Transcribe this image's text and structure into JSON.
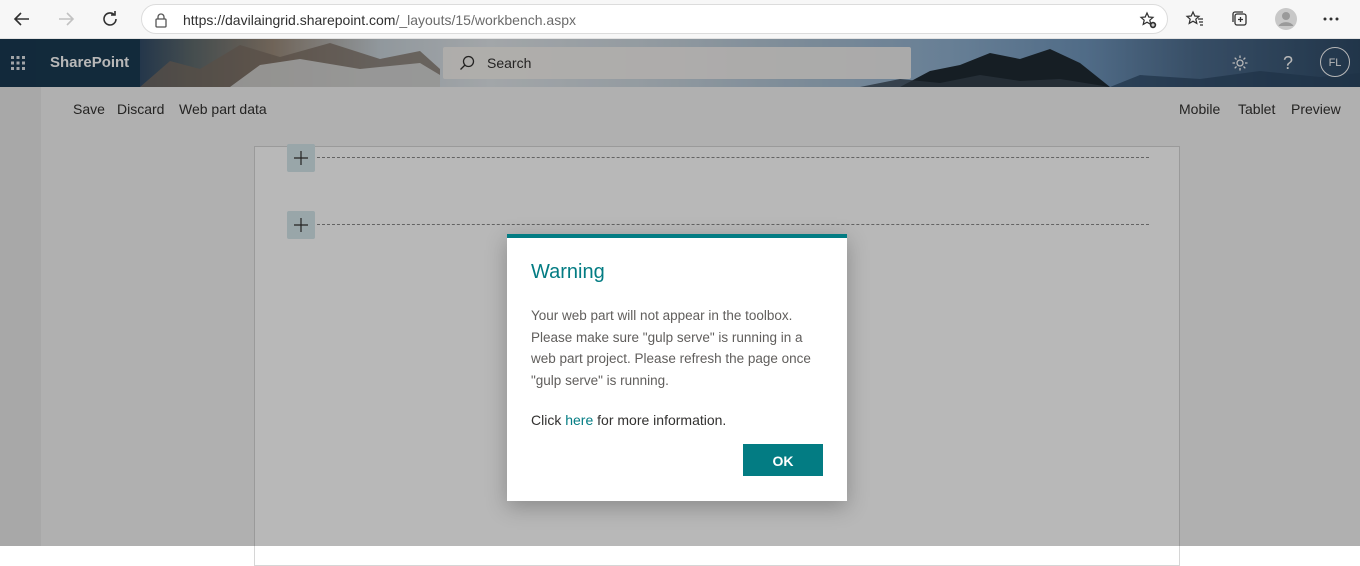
{
  "browser": {
    "url_host": "https://davilaingrid.sharepoint.com",
    "url_path": "/_layouts/15/workbench.aspx"
  },
  "suitebar": {
    "app_name": "SharePoint",
    "search_placeholder": "Search",
    "avatar_initials": "FL"
  },
  "toolbar": {
    "left": [
      "Save",
      "Discard",
      "Web part data"
    ],
    "right": [
      "Mobile",
      "Tablet",
      "Preview"
    ]
  },
  "dialog": {
    "title": "Warning",
    "body": "Your web part will not appear in the toolbox. Please make sure \"gulp serve\" is running in a web part project. Please refresh the page once \"gulp serve\" is running.",
    "info_prefix": "Click ",
    "info_link": "here",
    "info_suffix": " for more information.",
    "ok_label": "OK"
  },
  "colors": {
    "accent": "#037c83",
    "suitebar_dark": "#16384f"
  },
  "icons": [
    "back-icon",
    "forward-icon",
    "refresh-icon",
    "lock-icon",
    "add-favorite-icon",
    "favorites-icon",
    "collections-icon",
    "profile-icon",
    "more-icon",
    "waffle-icon",
    "search-icon",
    "gear-icon",
    "help-icon",
    "plus-icon"
  ]
}
